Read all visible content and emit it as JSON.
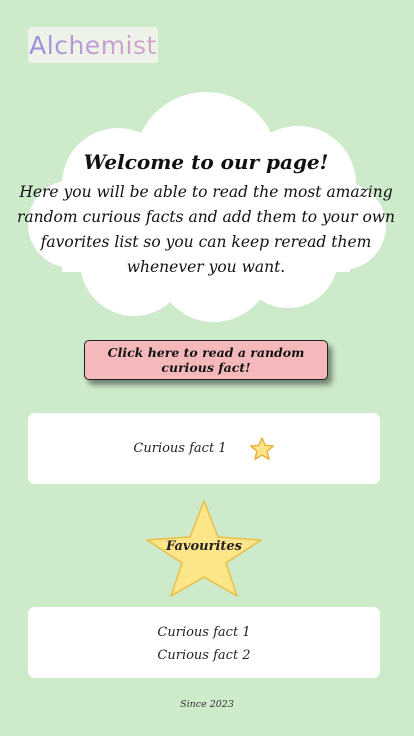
{
  "header": {
    "logo_text": "Alchemist"
  },
  "welcome": {
    "title": "Welcome to our page!",
    "body": "Here you will be able to read the most amazing random curious facts and add them to your own favorites list so you can keep reread them whenever you want."
  },
  "actions": {
    "random_fact_label": "Click here to read a random curious fact!"
  },
  "facts_panel": {
    "fact_text": "Curious fact 1",
    "favorite_icon": "star-icon"
  },
  "favourites": {
    "heading": "Favourites",
    "items": [
      "Curious fact 1",
      "Curious fact 2"
    ]
  },
  "footer": {
    "text": "Since 2023"
  },
  "colors": {
    "background": "#cdebcb",
    "button": "#f6b9bb",
    "star_fill": "#fde58a",
    "star_stroke": "#e9bf47"
  }
}
